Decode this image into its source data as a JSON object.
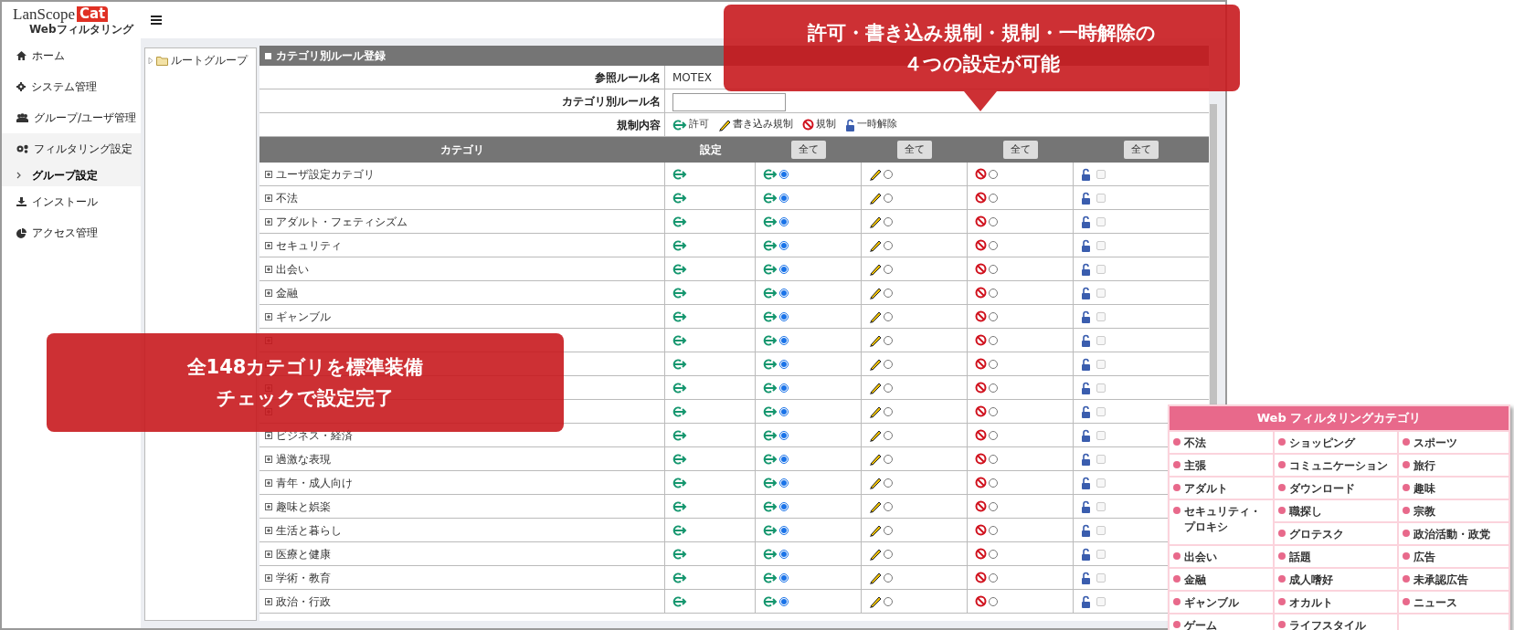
{
  "header": {
    "logo": {
      "word": "LanScope",
      "badge": "Cat",
      "subtitle": "Webフィルタリング"
    }
  },
  "sidebar": {
    "items": [
      {
        "label": "ホーム",
        "kind": "home",
        "selected": false,
        "expanded": false
      },
      {
        "label": "システム管理",
        "kind": "gear",
        "selected": false,
        "expanded": false
      },
      {
        "label": "グループ/ユーザ管理",
        "kind": "users",
        "selected": false,
        "expanded": false
      },
      {
        "label": "フィルタリング設定",
        "kind": "gears",
        "selected": false,
        "expanded": true,
        "children": [
          {
            "label": "グループ設定",
            "selected": true
          }
        ]
      },
      {
        "label": "インストール",
        "kind": "download",
        "selected": false,
        "expanded": false
      },
      {
        "label": "アクセス管理",
        "kind": "pie",
        "selected": false,
        "expanded": false
      }
    ]
  },
  "tree": {
    "items": [
      {
        "label": "ルートグループ",
        "expanded": false
      }
    ]
  },
  "rule_form": {
    "title": "カテゴリ別ルール登録",
    "fields": [
      {
        "label": "参照ルール名",
        "kind": "text",
        "value": "MOTEX"
      },
      {
        "label": "カテゴリ別ルール名",
        "kind": "input"
      },
      {
        "label": "規制内容",
        "kind": "legend",
        "items": [
          {
            "kind": "allow",
            "label": "許可"
          },
          {
            "kind": "write",
            "label": "書き込み規制"
          },
          {
            "kind": "block",
            "label": "規制"
          },
          {
            "kind": "unlock",
            "label": "一時解除"
          }
        ]
      }
    ]
  },
  "category_table": {
    "columns": [
      {
        "label": "カテゴリ"
      },
      {
        "label": "設定"
      },
      {
        "button": "全て"
      },
      {
        "button": "全て"
      },
      {
        "button": "全て"
      },
      {
        "button": "全て"
      }
    ],
    "rows": [
      {
        "label": "ユーザ設定カテゴリ",
        "allow": true,
        "write": false,
        "block": false,
        "unlock": false
      },
      {
        "label": "不法",
        "allow": true,
        "write": false,
        "block": false,
        "unlock": false
      },
      {
        "label": "アダルト・フェティシズム",
        "allow": true,
        "write": false,
        "block": false,
        "unlock": false
      },
      {
        "label": "セキュリティ",
        "allow": true,
        "write": false,
        "block": false,
        "unlock": false
      },
      {
        "label": "出会い",
        "allow": true,
        "write": false,
        "block": false,
        "unlock": false
      },
      {
        "label": "金融",
        "allow": true,
        "write": false,
        "block": false,
        "unlock": false
      },
      {
        "label": "ギャンブル",
        "allow": true,
        "write": false,
        "block": false,
        "unlock": false
      },
      {
        "allow": true,
        "write": false,
        "block": false,
        "unlock": false
      },
      {
        "allow": true,
        "write": false,
        "block": false,
        "unlock": false
      },
      {
        "allow": true,
        "write": false,
        "block": false,
        "unlock": false
      },
      {
        "allow": true,
        "write": false,
        "block": false,
        "unlock": false
      },
      {
        "label": "ビジネス・経済",
        "allow": true,
        "write": false,
        "block": false,
        "unlock": false
      },
      {
        "label": "過激な表現",
        "allow": true,
        "write": false,
        "block": false,
        "unlock": false
      },
      {
        "label": "青年・成人向け",
        "allow": true,
        "write": false,
        "block": false,
        "unlock": false
      },
      {
        "label": "趣味と娯楽",
        "allow": true,
        "write": false,
        "block": false,
        "unlock": false
      },
      {
        "label": "生活と暮らし",
        "allow": true,
        "write": false,
        "block": false,
        "unlock": false
      },
      {
        "label": "医療と健康",
        "allow": true,
        "write": false,
        "block": false,
        "unlock": false
      },
      {
        "label": "学術・教育",
        "allow": true,
        "write": false,
        "block": false,
        "unlock": false
      },
      {
        "label": "政治・行政",
        "allow": true,
        "write": false,
        "block": false,
        "unlock": false
      }
    ]
  },
  "callouts": [
    {
      "pointer": true,
      "lines": [
        "許可・書き込み規制・規制・一時解除の",
        "４つの設定が可能"
      ]
    },
    {
      "pointer": false,
      "lines": [
        "全148カテゴリを標準装備",
        "チェックで設定完了"
      ]
    }
  ],
  "category_panel": {
    "title": "Web フィルタリングカテゴリ",
    "columns": [
      [
        {
          "label": "不法",
          "kind": "normal"
        },
        {
          "label": "主張",
          "kind": "normal"
        },
        {
          "label": "アダルト",
          "kind": "normal"
        },
        {
          "label": "セキュリティ・プロキシ",
          "kind": "tall"
        },
        {
          "label": "出会い",
          "kind": "normal"
        },
        {
          "label": "金融",
          "kind": "normal"
        },
        {
          "label": "ギャンブル",
          "kind": "normal"
        },
        {
          "label": "ゲーム",
          "kind": "normal"
        }
      ],
      [
        {
          "label": "ショッピング",
          "kind": "normal"
        },
        {
          "label": "コミュニケーション",
          "kind": "normal"
        },
        {
          "label": "ダウンロード",
          "kind": "normal"
        },
        {
          "label": "職探し",
          "kind": "normal"
        },
        {
          "label": "グロテスク",
          "kind": "normal"
        },
        {
          "label": "話題",
          "kind": "normal"
        },
        {
          "label": "成人嗜好",
          "kind": "normal"
        },
        {
          "label": "オカルト",
          "kind": "normal"
        },
        {
          "label": "ライフスタイル",
          "kind": "normal"
        }
      ],
      [
        {
          "label": "スポーツ",
          "kind": "normal"
        },
        {
          "label": "旅行",
          "kind": "normal"
        },
        {
          "label": "趣味",
          "kind": "normal"
        },
        {
          "label": "宗教",
          "kind": "normal"
        },
        {
          "label": "政治活動・政党",
          "kind": "normal"
        },
        {
          "label": "広告",
          "kind": "normal"
        },
        {
          "label": "未承認広告",
          "kind": "normal"
        },
        {
          "label": "ニュース",
          "kind": "normal"
        }
      ]
    ]
  }
}
